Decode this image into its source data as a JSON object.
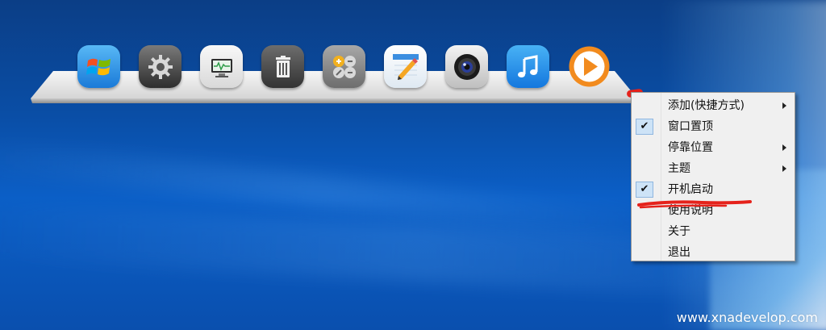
{
  "dock": {
    "icons": [
      {
        "name": "windows-icon",
        "color": "#1a7ad8"
      },
      {
        "name": "settings-gear-icon",
        "color": "#4a4a4a"
      },
      {
        "name": "system-monitor-icon",
        "color": "#2f9d49"
      },
      {
        "name": "trash-icon",
        "color": "#4a4a4a"
      },
      {
        "name": "calculator-icon",
        "color": "#f2b01e"
      },
      {
        "name": "notes-pencil-icon",
        "color": "#3b8ee0"
      },
      {
        "name": "camera-icon",
        "color": "#222222"
      },
      {
        "name": "music-icon",
        "color": "#1477de"
      },
      {
        "name": "media-player-icon",
        "color": "#f28b1e"
      }
    ]
  },
  "context_menu": {
    "items": [
      {
        "label": "添加(快捷方式)",
        "checked": false,
        "submenu": true
      },
      {
        "label": "窗口置顶",
        "checked": true,
        "submenu": false
      },
      {
        "label": "停靠位置",
        "checked": false,
        "submenu": true
      },
      {
        "label": "主题",
        "checked": false,
        "submenu": true
      },
      {
        "label": "开机启动",
        "checked": true,
        "submenu": false
      },
      {
        "label": "使用说明",
        "checked": false,
        "submenu": false
      },
      {
        "label": "关于",
        "checked": false,
        "submenu": false
      },
      {
        "label": "退出",
        "checked": false,
        "submenu": false
      }
    ],
    "check_glyph": "✔"
  },
  "watermark": "www.xnadevelop.com",
  "colors": {
    "annotation_red": "#e5221b",
    "menu_bg": "#f0f0f0",
    "check_bg": "#cde3f7"
  }
}
